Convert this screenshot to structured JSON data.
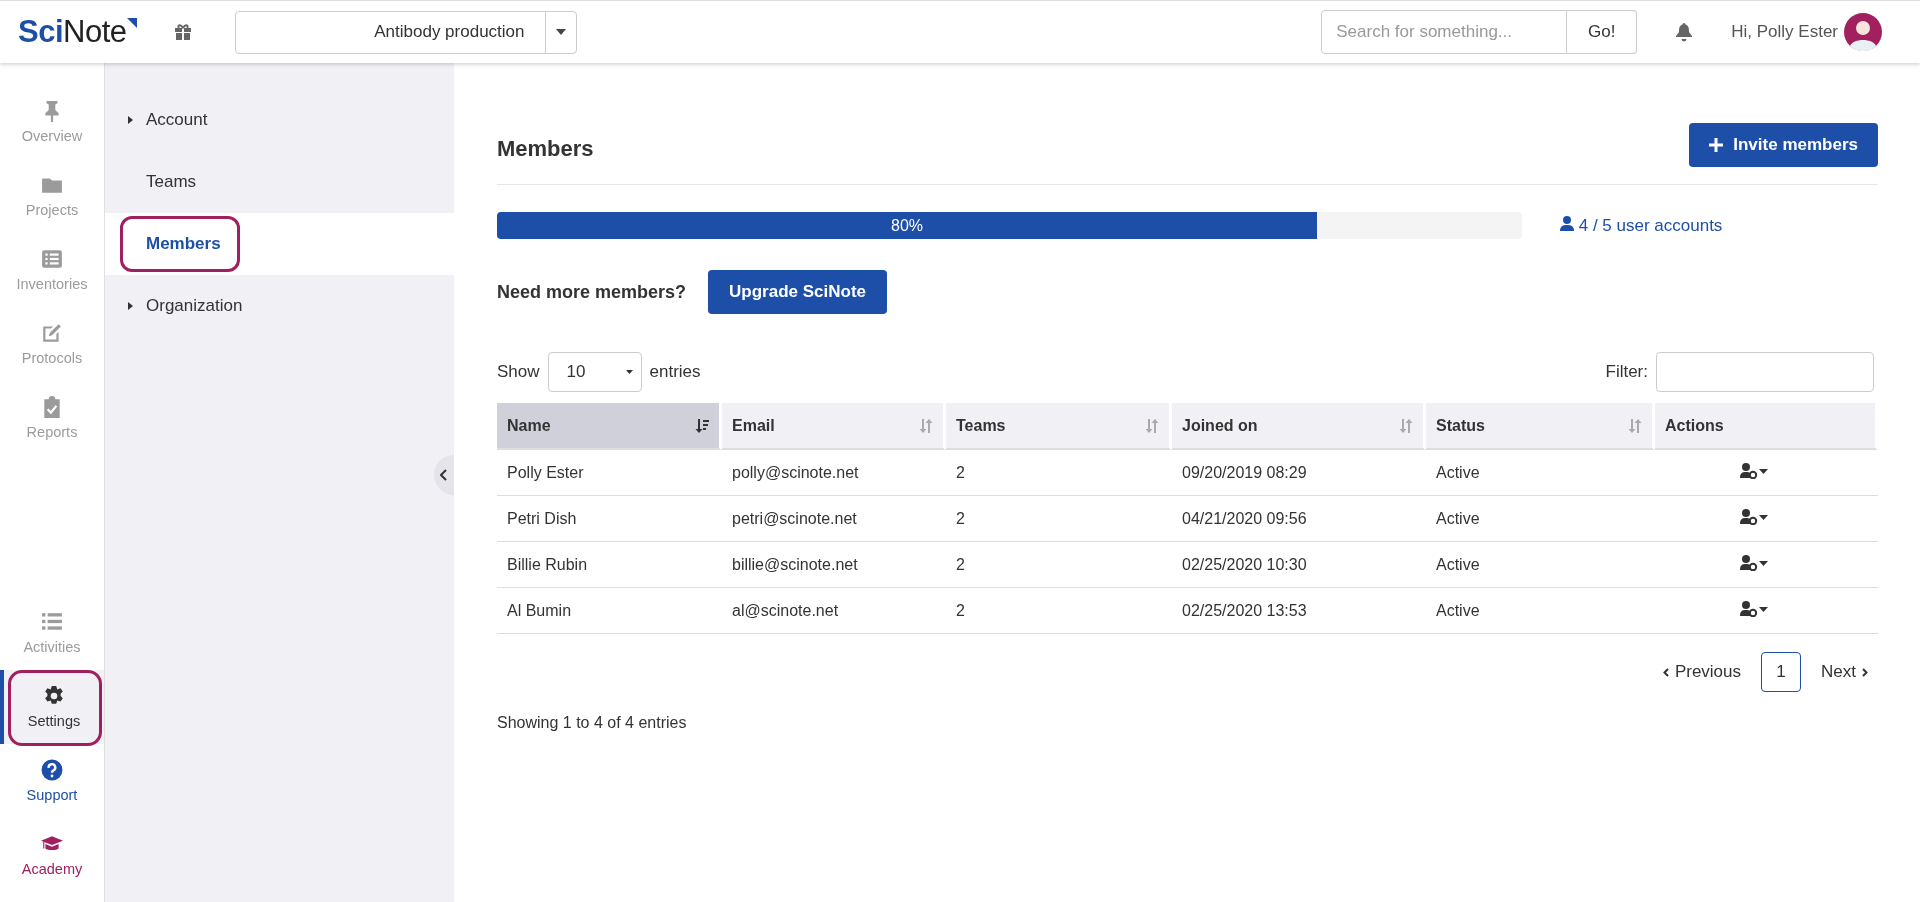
{
  "header": {
    "logo": "**Sci**Note",
    "project_selector": "Antibody production",
    "search": {
      "placeholder": "Search for something..."
    },
    "search_button": "Go!",
    "greeting": "Hi, Polly Ester"
  },
  "nav": {
    "items": [
      {
        "label": "Overview",
        "selected": false,
        "annotated": false,
        "color": "#9b9b9b"
      },
      {
        "label": "Projects",
        "selected": false,
        "annotated": false,
        "color": "#9b9b9b"
      },
      {
        "label": "Inventories",
        "selected": false,
        "annotated": false,
        "color": "#9b9b9b"
      },
      {
        "label": "Protocols",
        "selected": false,
        "annotated": false,
        "color": "#9b9b9b"
      },
      {
        "label": "Reports",
        "selected": false,
        "annotated": false,
        "color": "#9b9b9b"
      }
    ],
    "bottom_items": [
      {
        "label": "Activities",
        "selected": false,
        "annotated": false,
        "color": "#9b9b9b"
      },
      {
        "label": "Settings",
        "selected": true,
        "annotated": true,
        "color": "#333333"
      },
      {
        "label": "Support",
        "selected": false,
        "annotated": false,
        "color": "#1d4fa8"
      },
      {
        "label": "Academy",
        "selected": false,
        "annotated": false,
        "color": "#a0205f"
      }
    ]
  },
  "sidebar": {
    "items": [
      {
        "label": "Account",
        "expandable": true,
        "selected": false,
        "annotated": false
      },
      {
        "label": "Teams",
        "expandable": false,
        "selected": false,
        "annotated": false
      },
      {
        "label": "Members",
        "expandable": false,
        "selected": true,
        "annotated": true
      },
      {
        "label": "Organization",
        "expandable": true,
        "selected": false,
        "annotated": false
      }
    ]
  },
  "main": {
    "title": "Members",
    "invite_button": "Invite members",
    "usage": {
      "level": 0.8,
      "label": "80%",
      "accounts": "4 / 5 user accounts"
    },
    "upsell": {
      "text": "Need more members?",
      "button": "Upgrade SciNote"
    },
    "length": {
      "before": "Show",
      "value": "10",
      "after": "entries"
    },
    "filter": {
      "label": "Filter:"
    },
    "table": {
      "columns": [
        {
          "label": "Name",
          "sorted": true
        },
        {
          "label": "Email",
          "sorted": false
        },
        {
          "label": "Teams",
          "sorted": false
        },
        {
          "label": "Joined on",
          "sorted": false
        },
        {
          "label": "Status",
          "sorted": false
        },
        {
          "label": "Actions"
        }
      ],
      "rows": [
        [
          "Polly Ester",
          "polly@scinote.net",
          "2",
          "09/20/2019 08:29",
          "Active"
        ],
        [
          "Petri Dish",
          "petri@scinote.net",
          "2",
          "04/21/2020 09:56",
          "Active"
        ],
        [
          "Billie Rubin",
          "billie@scinote.net",
          "2",
          "02/25/2020 10:30",
          "Active"
        ],
        [
          "Al Bumin",
          "al@scinote.net",
          "2",
          "02/25/2020 13:53",
          "Active"
        ]
      ]
    },
    "pagination": {
      "previous": "Previous",
      "pages": [
        {
          "label": "1",
          "selected": true
        }
      ],
      "next": "Next"
    },
    "info": "Showing 1 to 4 of 4 entries"
  }
}
